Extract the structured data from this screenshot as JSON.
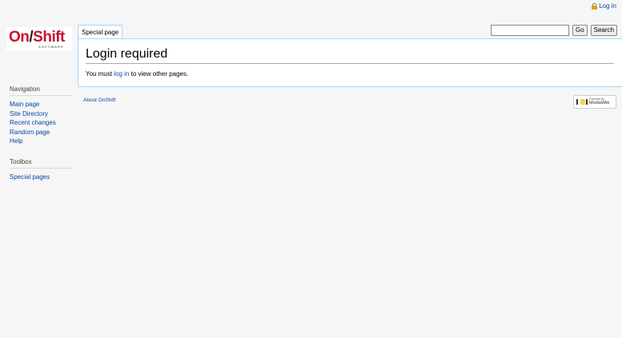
{
  "header": {
    "login_label": "Log in",
    "login_icon": "lock-icon"
  },
  "logo": {
    "left_word": "On",
    "right_word": "Shift",
    "subtitle": "SOFTWARE",
    "brand_red": "#c8102e"
  },
  "tabs": [
    {
      "label": "Special page"
    }
  ],
  "search": {
    "value": "",
    "placeholder": "",
    "go_label": "Go",
    "search_label": "Search"
  },
  "content": {
    "title": "Login required",
    "text_before": "You must ",
    "link_text": "log in",
    "text_after": " to view other pages."
  },
  "sidebar": {
    "navigation": {
      "title": "Navigation",
      "items": [
        "Main page",
        "Site Directory",
        "Recent changes",
        "Random page",
        "Help"
      ]
    },
    "toolbox": {
      "title": "Toolbox",
      "items": [
        "Special pages"
      ]
    }
  },
  "footer": {
    "about_link": "About OnShift",
    "powered_small": "Powered By",
    "powered_big": "MediaWiki"
  },
  "colors": {
    "link": "#0645ad",
    "border": "#a7d7f9",
    "background": "#f6f6f6"
  }
}
